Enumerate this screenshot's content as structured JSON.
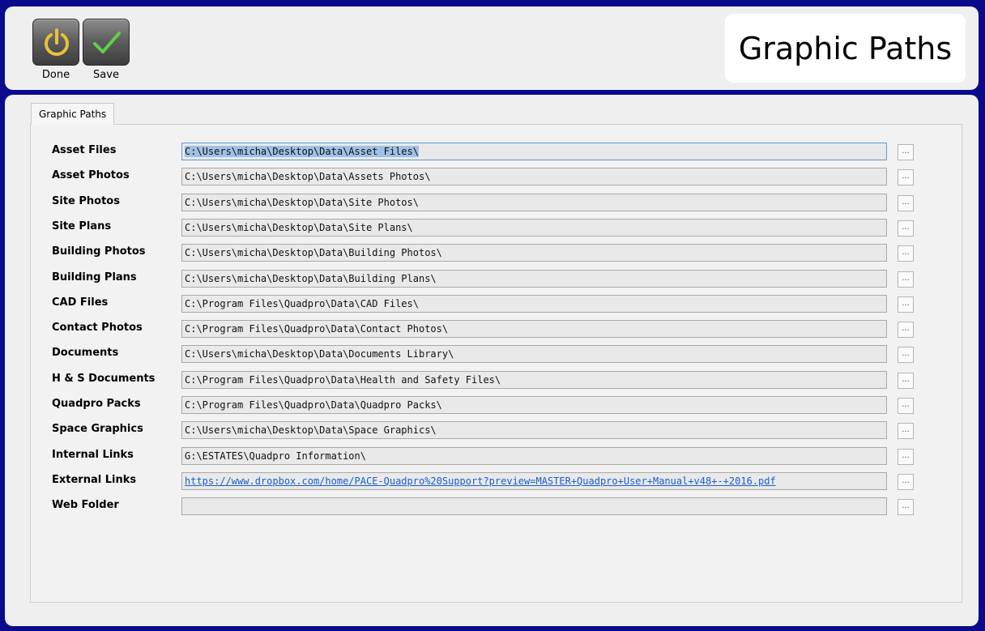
{
  "toolbar": {
    "done_label": "Done",
    "save_label": "Save"
  },
  "header": {
    "title": "Graphic Paths"
  },
  "tabs": [
    {
      "label": "Graphic Paths",
      "active": true
    }
  ],
  "browse_label": "...",
  "paths": [
    {
      "label": "Asset Files",
      "value": "C:\\Users\\micha\\Desktop\\Data\\Asset Files\\",
      "selected": true
    },
    {
      "label": "Asset Photos",
      "value": "C:\\Users\\micha\\Desktop\\Data\\Assets Photos\\"
    },
    {
      "label": "Site Photos",
      "value": "C:\\Users\\micha\\Desktop\\Data\\Site Photos\\"
    },
    {
      "label": "Site Plans",
      "value": "C:\\Users\\micha\\Desktop\\Data\\Site Plans\\"
    },
    {
      "label": "Building Photos",
      "value": "C:\\Users\\micha\\Desktop\\Data\\Building Photos\\"
    },
    {
      "label": "Building Plans",
      "value": "C:\\Users\\micha\\Desktop\\Data\\Building Plans\\"
    },
    {
      "label": "CAD Files",
      "value": "C:\\Program Files\\Quadpro\\Data\\CAD Files\\"
    },
    {
      "label": "Contact Photos",
      "value": "C:\\Program Files\\Quadpro\\Data\\Contact Photos\\"
    },
    {
      "label": "Documents",
      "value": "C:\\Users\\micha\\Desktop\\Data\\Documents Library\\"
    },
    {
      "label": "H & S Documents",
      "value": "C:\\Program Files\\Quadpro\\Data\\Health and Safety Files\\"
    },
    {
      "label": "Quadpro Packs",
      "value": "C:\\Program Files\\Quadpro\\Data\\Quadpro Packs\\"
    },
    {
      "label": "Space Graphics",
      "value": "C:\\Users\\micha\\Desktop\\Data\\Space Graphics\\"
    },
    {
      "label": "Internal Links",
      "value": "G:\\ESTATES\\Quadpro Information\\"
    },
    {
      "label": "External Links",
      "value": "https://www.dropbox.com/home/PACE-Quadpro%20Support?preview=MASTER+Quadpro+User+Manual+v48+-+2016.pdf",
      "link": true
    },
    {
      "label": "Web Folder",
      "value": ""
    }
  ],
  "colors": {
    "window_border": "#0a0a8c",
    "panel": "#efefef",
    "field": "#e9e9e9",
    "link": "#1a5fd0",
    "done_icon": "#e8c23a",
    "save_icon": "#5fd04a"
  },
  "icons": {
    "done": "power-icon",
    "save": "checkmark-icon"
  }
}
